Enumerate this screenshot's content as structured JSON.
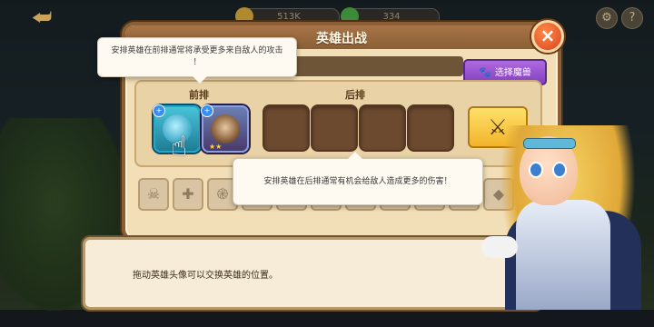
{
  "top_bar": {
    "gold": "513K",
    "gems": "334",
    "back_icon": "back-arrow-icon",
    "settings_icon": "gear-icon",
    "help_label": "?"
  },
  "panel": {
    "title": "英雄出战",
    "close_label": "×",
    "select_beast_label": "选择魔兽",
    "front_row_label": "前排",
    "back_row_label": "后排"
  },
  "tooltips": {
    "front": "安排英雄在前排通常将承受更多来自敌人的攻击\n！",
    "back": "安排英雄在后排通常有机会给敌人造成更多的伤害！"
  },
  "dialog": {
    "text": "拖动英雄头像可以交换英雄的位置。"
  },
  "filters": [
    "skull-icon",
    "cross-icon",
    "swirl-icon",
    "leaf-icon",
    "plus-icon",
    "shield-icon",
    "feather-icon",
    "flask-icon",
    "star-icon",
    "wing-icon"
  ],
  "colors": {
    "panel_bg": "#f2dfb8",
    "panel_border": "#8b5f35",
    "close_btn": "#d8431c",
    "beast_btn": "#8040c0",
    "battle_btn": "#f2b42a"
  }
}
